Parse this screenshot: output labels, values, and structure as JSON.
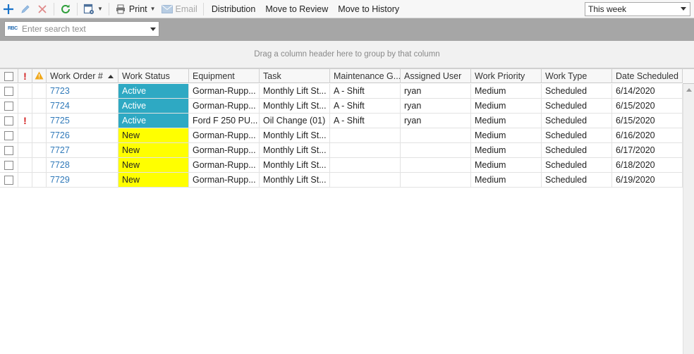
{
  "toolbar": {
    "print_label": "Print",
    "email_label": "Email",
    "distribution_label": "Distribution",
    "move_review_label": "Move to Review",
    "move_history_label": "Move to History",
    "icons": {
      "add": "plus-icon",
      "edit": "pencil-icon",
      "delete": "x-icon",
      "refresh": "refresh-icon",
      "layout": "grid-settings-icon",
      "print": "printer-icon",
      "email": "envelope-icon"
    },
    "colors": {
      "add": "#1a73c9",
      "delete": "#e08a8a",
      "refresh": "#2e9e3a"
    }
  },
  "period": {
    "selected": "This week"
  },
  "search": {
    "placeholder": "Enter search text",
    "value": ""
  },
  "group_panel": {
    "hint": "Drag a column header here to group by that column"
  },
  "grid": {
    "columns": {
      "work_order": "Work Order #",
      "work_status": "Work Status",
      "equipment": "Equipment",
      "task": "Task",
      "maintenance_group": "Maintenance G...",
      "assigned_user": "Assigned User",
      "work_priority": "Work Priority",
      "work_type": "Work Type",
      "date_scheduled": "Date Scheduled"
    },
    "status_colors": {
      "Active": "#2ea9c3",
      "New": "#ffff00"
    },
    "rows": [
      {
        "priority_flag": "",
        "work_order": "7723",
        "work_status": "Active",
        "equipment": "Gorman-Rupp...",
        "task": "Monthly Lift St...",
        "maintenance_group": "A - Shift",
        "assigned_user": "ryan",
        "work_priority": "Medium",
        "work_type": "Scheduled",
        "date_scheduled": "6/14/2020"
      },
      {
        "priority_flag": "",
        "work_order": "7724",
        "work_status": "Active",
        "equipment": "Gorman-Rupp...",
        "task": "Monthly Lift St...",
        "maintenance_group": "A - Shift",
        "assigned_user": "ryan",
        "work_priority": "Medium",
        "work_type": "Scheduled",
        "date_scheduled": "6/15/2020"
      },
      {
        "priority_flag": "!",
        "work_order": "7725",
        "work_status": "Active",
        "equipment": "Ford F 250 PU...",
        "task": "Oil Change (01)",
        "maintenance_group": "A - Shift",
        "assigned_user": "ryan",
        "work_priority": "Medium",
        "work_type": "Scheduled",
        "date_scheduled": "6/15/2020"
      },
      {
        "priority_flag": "",
        "work_order": "7726",
        "work_status": "New",
        "equipment": "Gorman-Rupp...",
        "task": "Monthly Lift St...",
        "maintenance_group": "",
        "assigned_user": "",
        "work_priority": "Medium",
        "work_type": "Scheduled",
        "date_scheduled": "6/16/2020"
      },
      {
        "priority_flag": "",
        "work_order": "7727",
        "work_status": "New",
        "equipment": "Gorman-Rupp...",
        "task": "Monthly Lift St...",
        "maintenance_group": "",
        "assigned_user": "",
        "work_priority": "Medium",
        "work_type": "Scheduled",
        "date_scheduled": "6/17/2020"
      },
      {
        "priority_flag": "",
        "work_order": "7728",
        "work_status": "New",
        "equipment": "Gorman-Rupp...",
        "task": "Monthly Lift St...",
        "maintenance_group": "",
        "assigned_user": "",
        "work_priority": "Medium",
        "work_type": "Scheduled",
        "date_scheduled": "6/18/2020"
      },
      {
        "priority_flag": "",
        "work_order": "7729",
        "work_status": "New",
        "equipment": "Gorman-Rupp...",
        "task": "Monthly Lift St...",
        "maintenance_group": "",
        "assigned_user": "",
        "work_priority": "Medium",
        "work_type": "Scheduled",
        "date_scheduled": "6/19/2020"
      }
    ]
  }
}
